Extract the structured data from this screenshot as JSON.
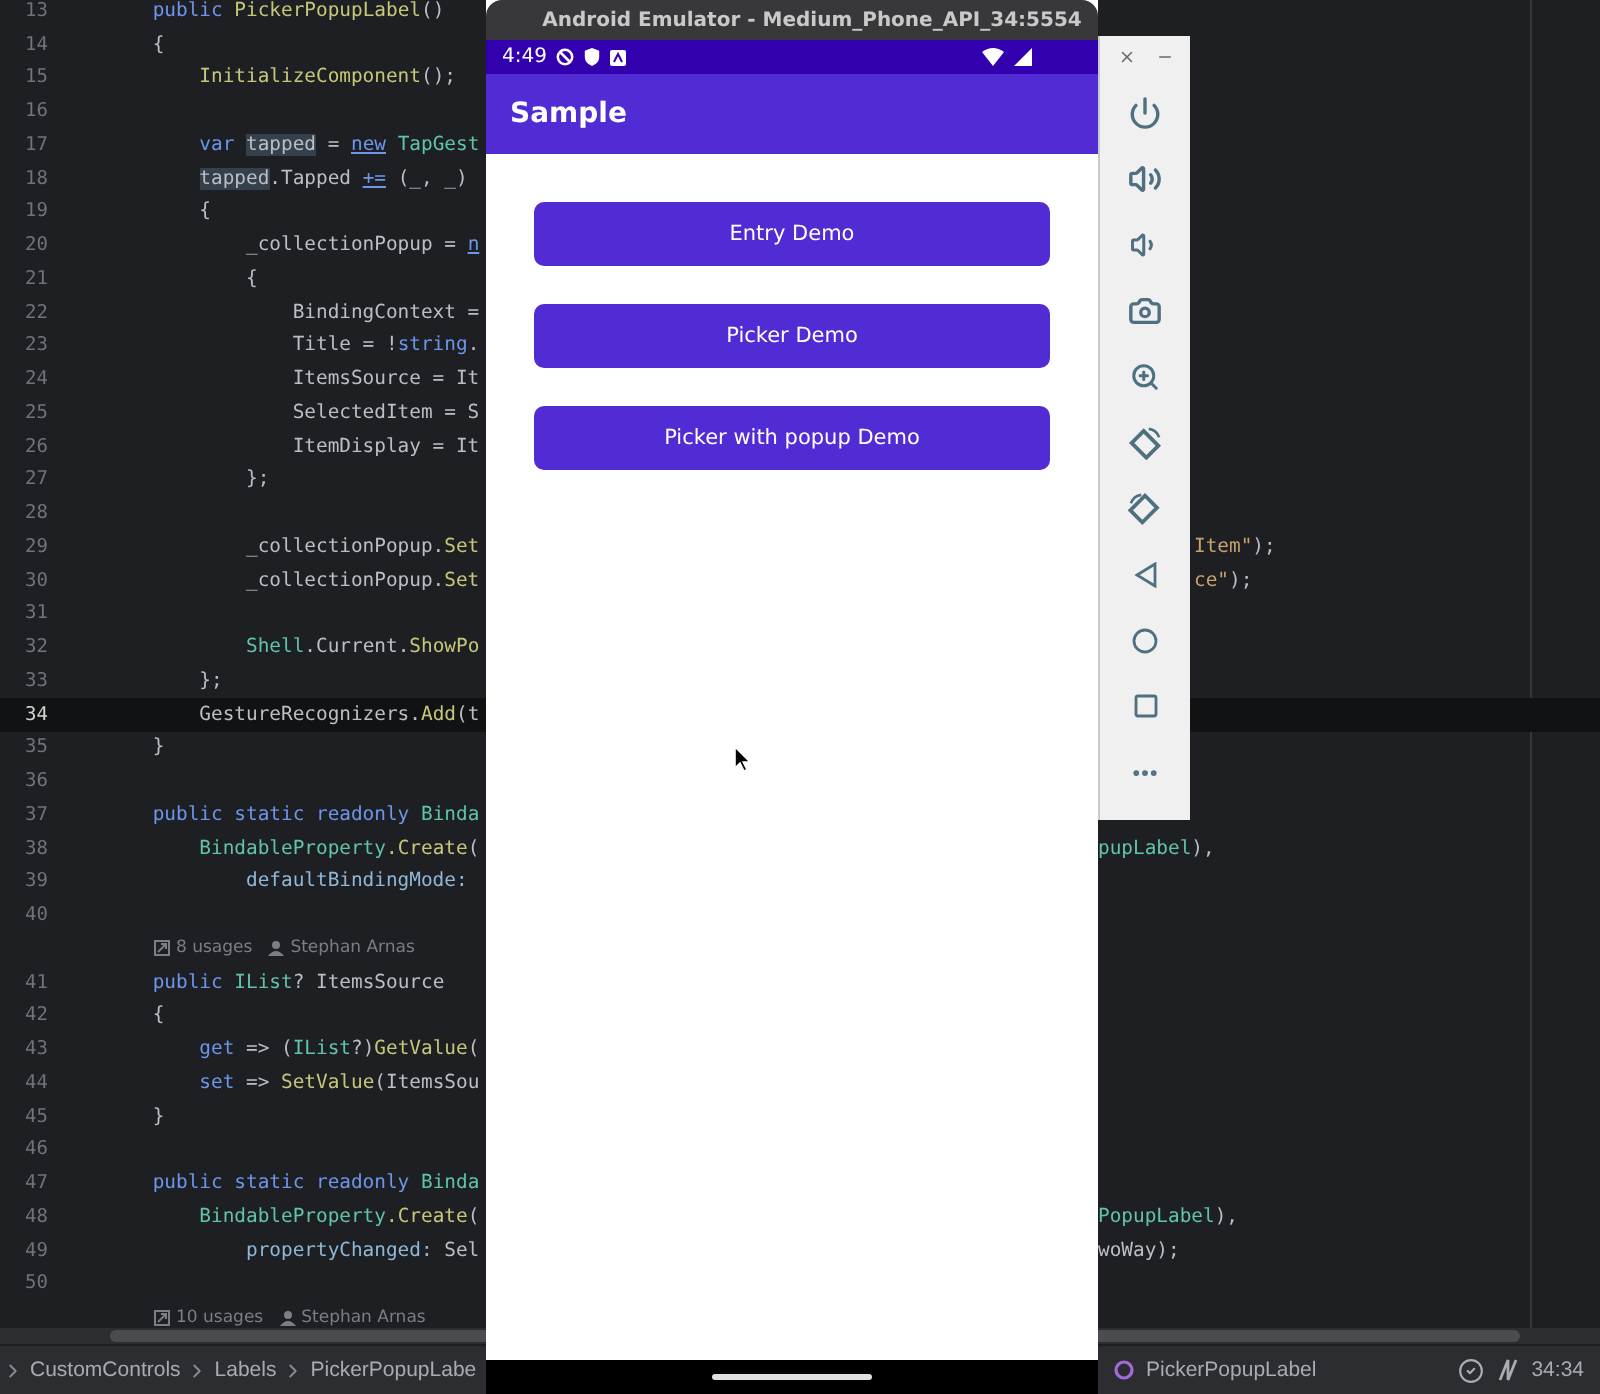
{
  "editor": {
    "lines": [
      {
        "kind": "code",
        "number": "13",
        "current": false,
        "tokens": [
          {
            "text": "    public",
            "kind": "kw"
          },
          {
            "text": " PickerPopupLabel",
            "kind": "fn"
          },
          {
            "text": "()",
            "kind": "p"
          }
        ]
      },
      {
        "kind": "code",
        "number": "14",
        "current": false,
        "tokens": [
          {
            "text": "    {",
            "kind": "p"
          }
        ]
      },
      {
        "kind": "code",
        "number": "15",
        "current": false,
        "tokens": [
          {
            "text": "        InitializeComponent",
            "kind": "fn"
          },
          {
            "text": "();",
            "kind": "p"
          }
        ]
      },
      {
        "kind": "code",
        "number": "16",
        "current": false
      },
      {
        "kind": "code",
        "number": "17",
        "current": false,
        "tokens": [
          {
            "text": "        var ",
            "kind": "kw"
          },
          {
            "text": "tapped",
            "kind": "hl"
          },
          {
            "text": " = ",
            "kind": "p"
          },
          {
            "text": "new",
            "kind": "link"
          },
          {
            "text": " TapGest",
            "kind": "type"
          }
        ]
      },
      {
        "kind": "code",
        "number": "18",
        "current": false,
        "tokens": [
          {
            "text": "tapped",
            "kind": "hl"
          },
          {
            "text": ".Tapped ",
            "kind": "p"
          },
          {
            "text": "+=",
            "kind": "link"
          },
          {
            "text": " (_, _)",
            "kind": "p"
          }
        ]
      },
      {
        "kind": "code",
        "number": "19",
        "current": false,
        "tokens": [
          {
            "text": "        {",
            "kind": "p"
          }
        ]
      },
      {
        "kind": "code",
        "number": "20",
        "current": false,
        "tokens": [
          {
            "text": "            _collectionPopup = ",
            "kind": "p"
          },
          {
            "text": "n",
            "kind": "link"
          }
        ]
      },
      {
        "kind": "code",
        "number": "21",
        "current": false,
        "tokens": [
          {
            "text": "            {",
            "kind": "p"
          }
        ]
      },
      {
        "kind": "code",
        "number": "22",
        "current": false,
        "tokens": [
          {
            "text": "                BindingContext =",
            "kind": "p"
          }
        ]
      },
      {
        "kind": "code",
        "number": "23",
        "current": false,
        "tokens": [
          {
            "text": "                Title = !",
            "kind": "p"
          },
          {
            "text": "string",
            "kind": "kw"
          },
          {
            "text": ".",
            "kind": "p"
          }
        ]
      },
      {
        "kind": "code",
        "number": "24",
        "current": false,
        "tokens": [
          {
            "text": "                ItemsSource = It",
            "kind": "p"
          }
        ]
      },
      {
        "kind": "code",
        "number": "25",
        "current": false,
        "tokens": [
          {
            "text": "                SelectedItem = S",
            "kind": "p"
          }
        ]
      },
      {
        "kind": "code",
        "number": "26",
        "current": false,
        "tokens": [
          {
            "text": "                ItemDisplay = It",
            "kind": "p"
          }
        ]
      },
      {
        "kind": "code",
        "number": "27",
        "current": false,
        "tokens": [
          {
            "text": "            };",
            "kind": "p"
          }
        ]
      },
      {
        "kind": "code",
        "number": "28",
        "current": false
      },
      {
        "kind": "code",
        "number": "29",
        "current": false,
        "tokens": [
          {
            "text": "            _collectionPopup.",
            "kind": "p"
          },
          {
            "text": "Set",
            "kind": "fn"
          }
        ],
        "tail": [
          {
            "text": "Item\"",
            "kind": "str"
          },
          {
            "text": ");",
            "kind": "p"
          }
        ]
      },
      {
        "kind": "code",
        "number": "30",
        "current": false,
        "tokens": [
          {
            "text": "            _collectionPopup.",
            "kind": "p"
          },
          {
            "text": "Set",
            "kind": "fn"
          }
        ],
        "tail": [
          {
            "text": "ce\"",
            "kind": "str"
          },
          {
            "text": ");",
            "kind": "p"
          }
        ]
      },
      {
        "kind": "code",
        "number": "31",
        "current": false
      },
      {
        "kind": "code",
        "number": "32",
        "current": false,
        "tokens": [
          {
            "text": "            Shell",
            "kind": "type"
          },
          {
            "text": ".Current.",
            "kind": "p"
          },
          {
            "text": "ShowPo",
            "kind": "fn"
          }
        ]
      },
      {
        "kind": "code",
        "number": "33",
        "current": false,
        "tokens": [
          {
            "text": "        };",
            "kind": "p"
          }
        ]
      },
      {
        "kind": "code",
        "number": "34",
        "current": true,
        "tokens": [
          {
            "text": "        GestureRecognizers.",
            "kind": "p"
          },
          {
            "text": "Add",
            "kind": "fn"
          },
          {
            "text": "(t",
            "kind": "p"
          }
        ]
      },
      {
        "kind": "code",
        "number": "35",
        "current": false,
        "tokens": [
          {
            "text": "    }",
            "kind": "p"
          }
        ]
      },
      {
        "kind": "code",
        "number": "36",
        "current": false
      },
      {
        "kind": "code",
        "number": "37",
        "current": false,
        "tokens": [
          {
            "text": "    public static readonly",
            "kind": "kw"
          },
          {
            "text": " Binda",
            "kind": "type"
          }
        ]
      },
      {
        "kind": "code",
        "number": "38",
        "current": false,
        "tokens": [
          {
            "text": "        BindableProperty",
            "kind": "type"
          },
          {
            "text": ".Create",
            "kind": "fn"
          },
          {
            "text": "(",
            "kind": "p"
          }
        ],
        "tail": [
          {
            "text": "pupLabel",
            "kind": "type"
          },
          {
            "text": "),",
            "kind": "p"
          }
        ]
      },
      {
        "kind": "code",
        "number": "39",
        "current": false,
        "tokens": [
          {
            "text": "            defaultBindingMode:",
            "kind": "param"
          }
        ]
      },
      {
        "kind": "code",
        "number": "40",
        "current": false
      },
      {
        "kind": "annotation",
        "usages": "8 usages",
        "author": "Stephan Arnas"
      },
      {
        "kind": "code",
        "number": "41",
        "current": false,
        "tokens": [
          {
            "text": "    public",
            "kind": "kw"
          },
          {
            "text": " IList",
            "kind": "type"
          },
          {
            "text": "? ItemsSource",
            "kind": "p"
          }
        ]
      },
      {
        "kind": "code",
        "number": "42",
        "current": false,
        "tokens": [
          {
            "text": "    {",
            "kind": "p"
          }
        ]
      },
      {
        "kind": "code",
        "number": "43",
        "current": false,
        "tokens": [
          {
            "text": "        get",
            "kind": "kw"
          },
          {
            "text": " => (",
            "kind": "p"
          },
          {
            "text": "IList",
            "kind": "type"
          },
          {
            "text": "?)",
            "kind": "p"
          },
          {
            "text": "GetValue",
            "kind": "fn"
          },
          {
            "text": "(",
            "kind": "p"
          }
        ]
      },
      {
        "kind": "code",
        "number": "44",
        "current": false,
        "tokens": [
          {
            "text": "        set",
            "kind": "kw"
          },
          {
            "text": " => ",
            "kind": "p"
          },
          {
            "text": "SetValue",
            "kind": "fn"
          },
          {
            "text": "(ItemsSou",
            "kind": "p"
          }
        ]
      },
      {
        "kind": "code",
        "number": "45",
        "current": false,
        "tokens": [
          {
            "text": "    }",
            "kind": "p"
          }
        ]
      },
      {
        "kind": "code",
        "number": "46",
        "current": false
      },
      {
        "kind": "code",
        "number": "47",
        "current": false,
        "tokens": [
          {
            "text": "    public static readonly",
            "kind": "kw"
          },
          {
            "text": " Binda",
            "kind": "type"
          }
        ]
      },
      {
        "kind": "code",
        "number": "48",
        "current": false,
        "tokens": [
          {
            "text": "        BindableProperty",
            "kind": "type"
          },
          {
            "text": ".Create",
            "kind": "fn"
          },
          {
            "text": "(",
            "kind": "p"
          }
        ],
        "tail": [
          {
            "text": "PopupLabel",
            "kind": "type"
          },
          {
            "text": "),",
            "kind": "p"
          }
        ]
      },
      {
        "kind": "code",
        "number": "49",
        "current": false,
        "tokens": [
          {
            "text": "            propertyChanged:",
            "kind": "param"
          },
          {
            "text": " Sel",
            "kind": "p"
          }
        ],
        "tail": [
          {
            "text": "woWay);",
            "kind": "p"
          }
        ]
      },
      {
        "kind": "code",
        "number": "50",
        "current": false
      },
      {
        "kind": "annotation",
        "usages": "10 usages",
        "author": "Stephan Arnas"
      }
    ]
  },
  "status_bar": {
    "breadcrumbs": [
      "CustomControls",
      "Labels",
      "PickerPopupLabe"
    ],
    "file": "PickerPopupLabel",
    "position": "34:34"
  },
  "emulator": {
    "title": "Android Emulator - Medium_Phone_API_34:5554",
    "time": "4:49",
    "app_title": "Sample",
    "buttons": [
      "Entry Demo",
      "Picker Demo",
      "Picker with popup Demo"
    ]
  }
}
